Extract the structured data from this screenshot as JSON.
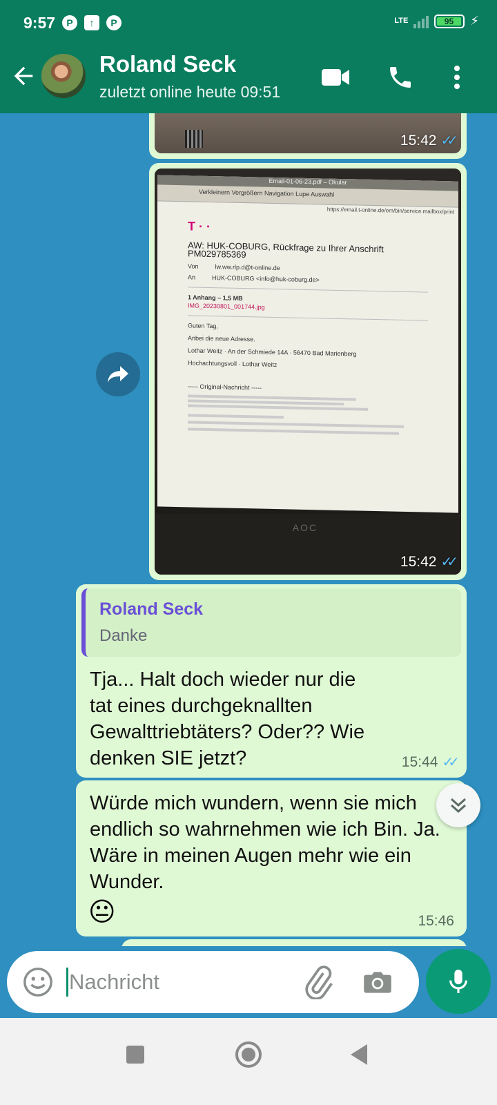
{
  "status_bar": {
    "time": "9:57",
    "network": "LTE",
    "battery": "95"
  },
  "header": {
    "contact_name": "Roland Seck",
    "subtitle": "zuletzt online heute 09:51"
  },
  "messages": [
    {
      "type": "image",
      "time": "15:42",
      "status": "read"
    },
    {
      "type": "image",
      "time": "15:42",
      "status": "read",
      "document": {
        "window_title": "Email-01-06-23.pdf – Okular",
        "toolbar": "Verkleinern   Vergrößern   Navigation   Lupe   Auswahl",
        "url": "https://email.t-online.de/em/bin/service.mailbox/print",
        "logo": "T · ·",
        "subject": "AW: HUK-COBURG, Rückfrage zu Ihrer Anschrift PM029785369",
        "from_label": "Von",
        "from_value": "lw.ww.rlp.d@t-online.de",
        "to_label": "An",
        "to_value": "HUK-COBURG <info@huk-coburg.de>",
        "attachment": "1 Anhang – 1,5 MB",
        "attachment_file": "IMG_20230801_001744.jpg",
        "greeting": "Guten Tag,",
        "line1": "Anbei die neue Adresse.",
        "address": "Lothar Weitz · An der Schmiede 14A · 56470 Bad Marienberg",
        "closing": "Hochachtungsvoll · Lothar Weitz",
        "original": "----- Original-Nachricht -----",
        "brand": "AOC"
      }
    },
    {
      "type": "text",
      "quote_name": "Roland Seck",
      "quote_text": "Danke",
      "text": "Tja... Halt doch wieder nur die tat eines durchgeknallten Gewalttriebtäters? Oder?? Wie denken SIE jetzt?",
      "time": "15:44",
      "status": "read"
    },
    {
      "type": "text",
      "text": "Würde mich wundern, wenn sie mich endlich so wahrnehmen wie ich Bin. Ja. Wäre in meinen Augen mehr wie ein Wunder.",
      "emoji": "😐",
      "time": "15:46"
    }
  ],
  "composer": {
    "placeholder": "Nachricht"
  },
  "colors": {
    "header": "#0a7d5e",
    "chat_background": "#2e8fc0",
    "bubble": "#e0f9d5",
    "quote_accent": "#6a4fd6",
    "read_ticks": "#54b8f0",
    "mic_button": "#0a9b76"
  },
  "icons": [
    "back-arrow-icon",
    "video-call-icon",
    "phone-icon",
    "more-vert-icon",
    "forward-icon",
    "emoji-icon",
    "attach-icon",
    "camera-icon",
    "mic-icon",
    "scroll-down-icon"
  ]
}
